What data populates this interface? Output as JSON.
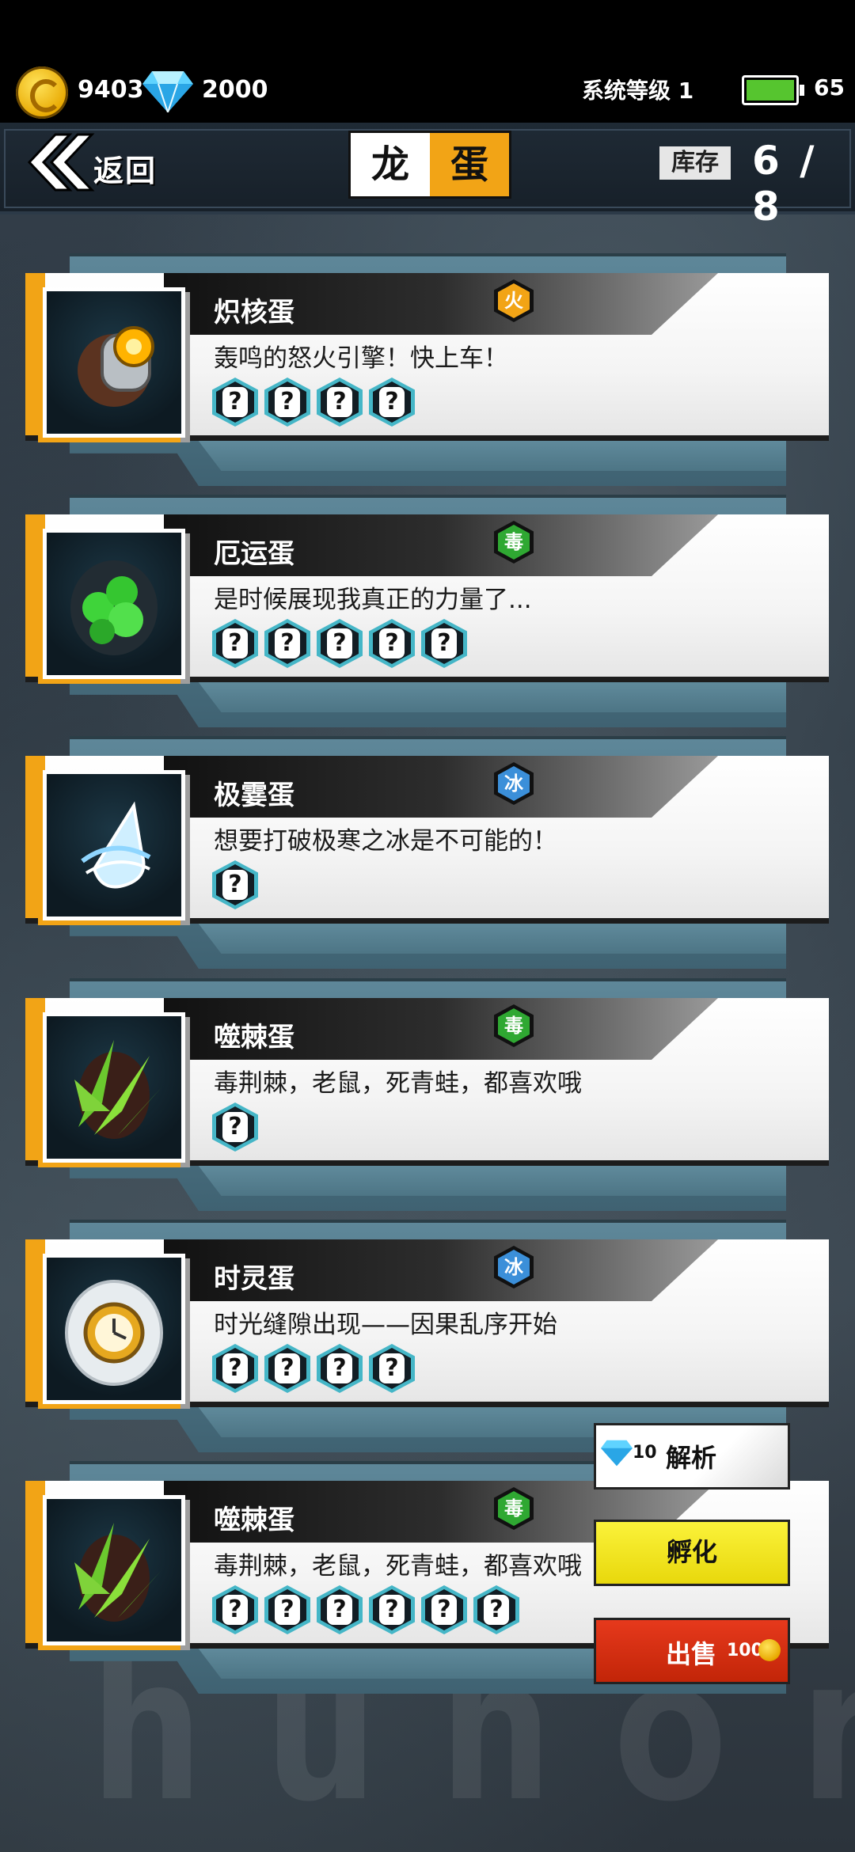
{
  "status": {
    "coins": "9403",
    "gems": "2000",
    "system_level": "系统等级 1",
    "battery": "65"
  },
  "header": {
    "back_label": "返回",
    "title_left": "龙",
    "title_right": "蛋",
    "stock_label": "库存",
    "stock_value": "6 / 8"
  },
  "eggs": [
    {
      "name": "炽核蛋",
      "element": "火",
      "element_color": "#f2a416",
      "description": "轰鸣的怒火引擎！快上车！",
      "slots": 4,
      "icon": "engine-egg-icon"
    },
    {
      "name": "厄运蛋",
      "element": "毒",
      "element_color": "#2fa832",
      "description": "是时候展现我真正的力量了...",
      "slots": 5,
      "icon": "doom-egg-icon"
    },
    {
      "name": "极霎蛋",
      "element": "冰",
      "element_color": "#3b8fd9",
      "description": "想要打破极寒之冰是不可能的！",
      "slots": 1,
      "icon": "ice-egg-icon"
    },
    {
      "name": "噬棘蛋",
      "element": "毒",
      "element_color": "#2fa832",
      "description": "毒荆棘，老鼠，死青蛙，都喜欢哦",
      "slots": 1,
      "icon": "thorn-egg-icon"
    },
    {
      "name": "时灵蛋",
      "element": "冰",
      "element_color": "#3b8fd9",
      "description": "时光缝隙出现——因果乱序开始",
      "slots": 4,
      "icon": "clock-egg-icon"
    },
    {
      "name": "噬棘蛋",
      "element": "毒",
      "element_color": "#2fa832",
      "description": "毒荆棘，老鼠，死青蛙，都喜欢哦",
      "slots": 6,
      "icon": "thorn-egg-icon"
    }
  ],
  "slot_mark": "?",
  "actions": {
    "analyze_cost": "10",
    "analyze_label": "解析",
    "hatch_label": "孵化",
    "sell_label": "出售",
    "sell_price": "100"
  }
}
